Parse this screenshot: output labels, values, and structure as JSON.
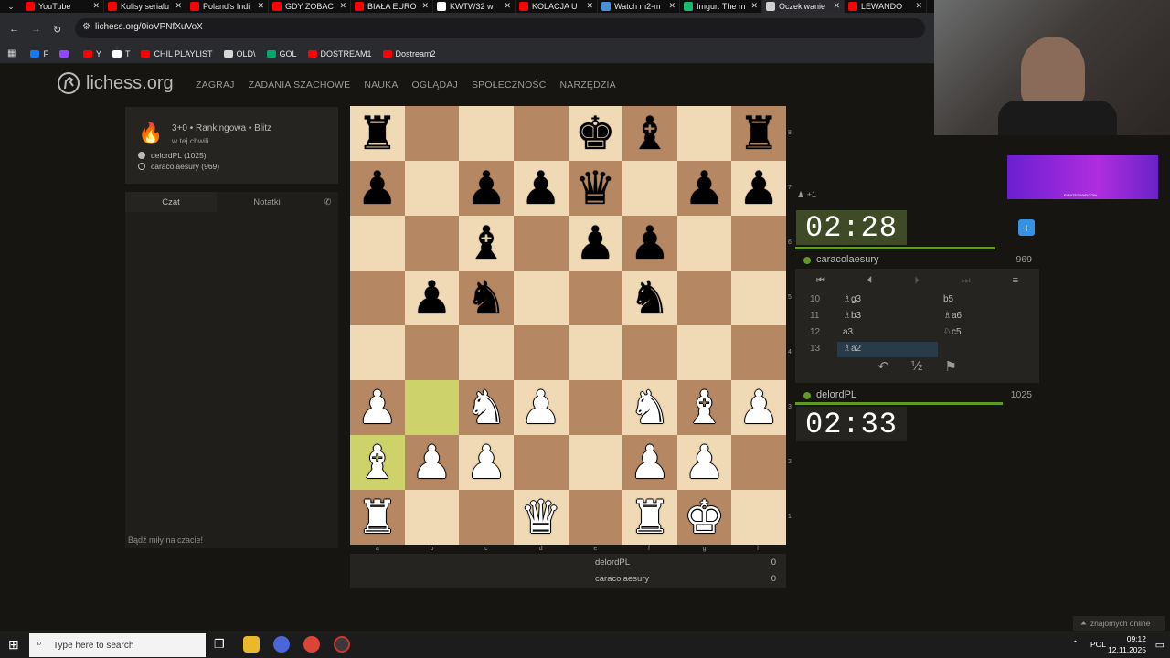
{
  "browser": {
    "tabs": [
      {
        "title": "YouTube",
        "color": "#ff0000"
      },
      {
        "title": "Kulisy serialu",
        "color": "#ff0000"
      },
      {
        "title": "Poland's Indi",
        "color": "#ff0000"
      },
      {
        "title": "GDY ZOBAC",
        "color": "#ff0000"
      },
      {
        "title": "BIAŁA EURO",
        "color": "#ff0000"
      },
      {
        "title": "KWTW32 w",
        "color": "#ffffff"
      },
      {
        "title": "KOLACJA U",
        "color": "#ff0000"
      },
      {
        "title": "Watch m2-m",
        "color": "#4a90d9"
      },
      {
        "title": "Imgur: The m",
        "color": "#1bb76e"
      },
      {
        "title": "Oczekiwanie",
        "color": "#d0d0d0",
        "active": true
      },
      {
        "title": "LEWANDO",
        "color": "#ff0000"
      }
    ],
    "url": "lichess.org/0ioVPNfXuVoX",
    "bookmarks": [
      {
        "label": "F",
        "color": "#1877f2"
      },
      {
        "label": "",
        "color": "#9146ff"
      },
      {
        "label": "Y",
        "color": "#ff0000"
      },
      {
        "label": "T",
        "color": "#ffffff"
      },
      {
        "label": "CHIL PLAYLIST",
        "color": "#ff0000"
      },
      {
        "label": "OLD\\",
        "color": "#d6d6d6"
      },
      {
        "label": "GOL",
        "color": "#00a86b"
      },
      {
        "label": "DOSTREAM1",
        "color": "#ff0000"
      },
      {
        "label": "Dostream2",
        "color": "#ff0000"
      }
    ]
  },
  "site": {
    "logo": "lichess.org",
    "nav": [
      "ZAGRAJ",
      "ZADANIA SZACHOWE",
      "NAUKA",
      "OGLĄDAJ",
      "SPOŁECZNOŚĆ",
      "NARZĘDZIA"
    ]
  },
  "game": {
    "type": "3+0 • Rankingowa • Blitz",
    "time": "w tej chwili",
    "white": "delordPL (1025)",
    "black": "caracolaesury (969)"
  },
  "chat": {
    "tab_chat": "Czat",
    "tab_notes": "Notatki",
    "placeholder": "Bądź miły na czacie!"
  },
  "board": {
    "files": [
      "a",
      "b",
      "c",
      "d",
      "e",
      "f",
      "g",
      "h"
    ],
    "ranks": [
      "8",
      "7",
      "6",
      "5",
      "4",
      "3",
      "2",
      "1"
    ],
    "highlights": [
      "b3",
      "a2"
    ],
    "pieces": {
      "a8": "r",
      "e8": "k",
      "f8": "b",
      "h8": "r",
      "a7": "p",
      "c7": "p",
      "d7": "p",
      "e7": "q",
      "g7": "p",
      "h7": "p",
      "c6": "b",
      "e6": "p",
      "f6": "p",
      "b5": "p",
      "c5": "n",
      "f5": "n",
      "a3": "P",
      "c3": "N",
      "d3": "P",
      "f3": "N",
      "g3": "B",
      "h3": "P",
      "a2": "B",
      "b2": "P",
      "c2": "P",
      "f2": "P",
      "g2": "P",
      "a1": "R",
      "d1": "Q",
      "f1": "R",
      "g1": "K"
    }
  },
  "score": {
    "rows": [
      {
        "name": "delordPL",
        "score": "0"
      },
      {
        "name": "caracolaesury",
        "score": "0"
      }
    ]
  },
  "right": {
    "spectators": "+1",
    "top_clock": "02:28",
    "top_player": "caracolaesury",
    "top_rating": "969",
    "bottom_clock": "02:33",
    "bottom_player": "delordPL",
    "bottom_rating": "1025",
    "top_time_fraction": 0.82,
    "bottom_time_fraction": 0.85,
    "moves": [
      {
        "n": "10",
        "w": "♗g3",
        "b": "b5"
      },
      {
        "n": "11",
        "w": "♗b3",
        "b": "♗a6"
      },
      {
        "n": "12",
        "w": "a3",
        "b": "♘c5"
      },
      {
        "n": "13",
        "w": "♗a2",
        "b": "",
        "current": true
      }
    ],
    "draw_label": "½"
  },
  "banner": "PIRATESWAP.COM",
  "friends": "znajomych online",
  "taskbar": {
    "search_placeholder": "Type here to search",
    "lang": "POL",
    "time": "09:12",
    "date": "12.11.2025"
  }
}
